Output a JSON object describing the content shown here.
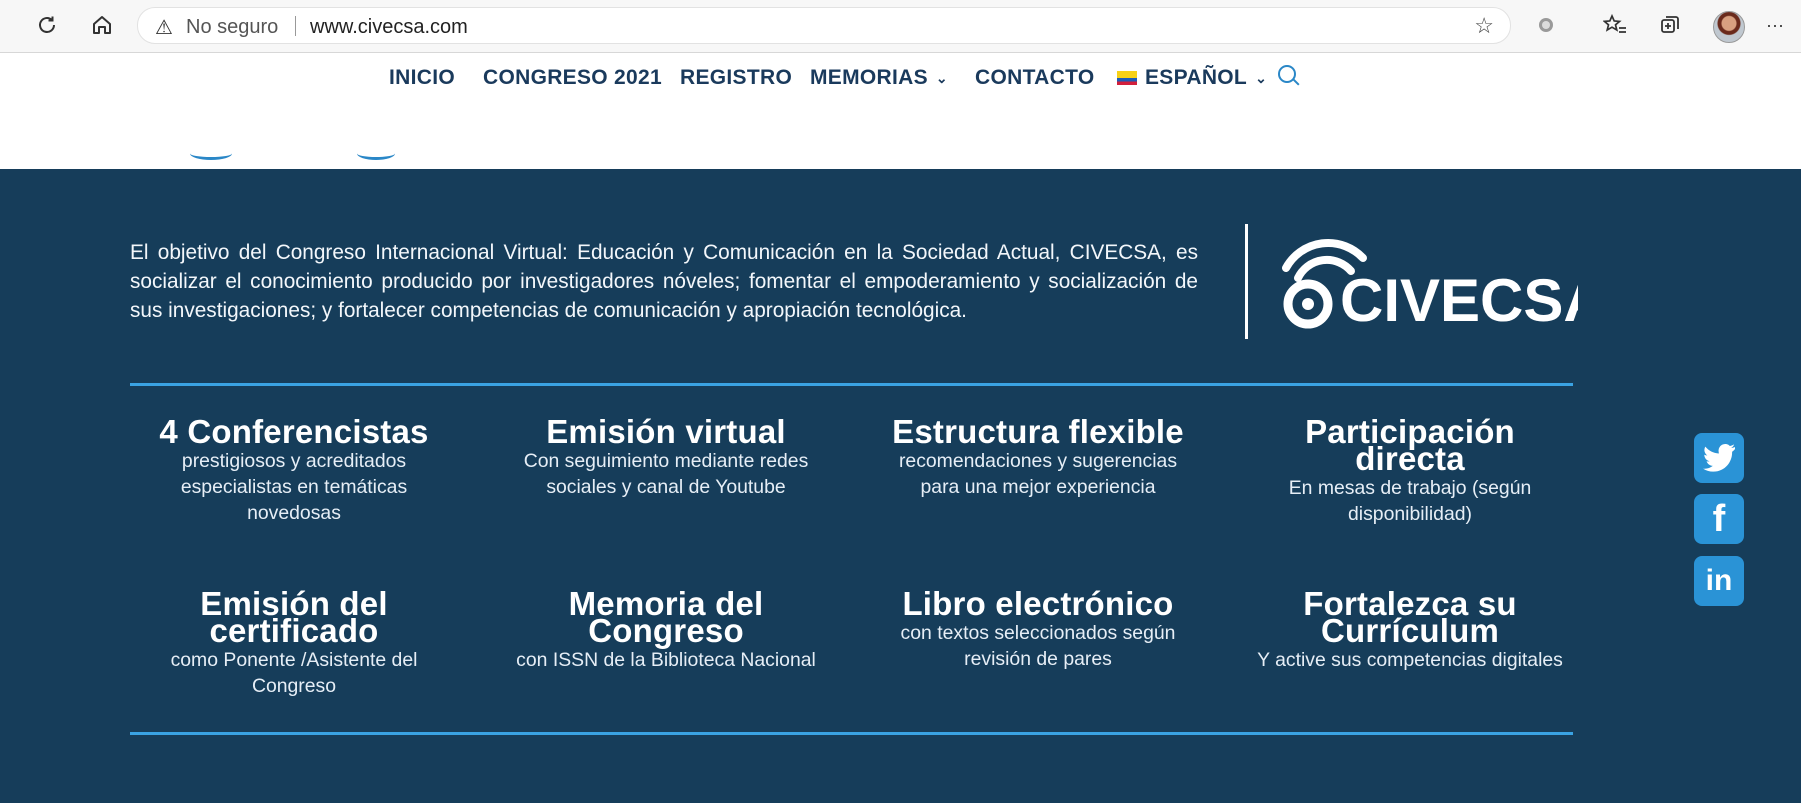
{
  "browser": {
    "security_label": "No seguro",
    "url": "www.civecsa.com",
    "icons": [
      "refresh-icon",
      "home-icon",
      "warning-icon",
      "add-favorite-icon",
      "extension-icon",
      "favorites-icon",
      "collections-icon",
      "profile-avatar",
      "more-icon"
    ]
  },
  "nav": {
    "items": [
      {
        "label": "INICIO"
      },
      {
        "label": "CONGRESO 2021"
      },
      {
        "label": "REGISTRO"
      },
      {
        "label": "MEMORIAS"
      },
      {
        "label": "CONTACTO"
      },
      {
        "label": "ESPAÑOL"
      }
    ]
  },
  "hero": {
    "intro": "El objetivo del Congreso Internacional Virtual: Educación y Comunicación en la Sociedad Actual, CIVECSA, es socializar el conocimiento producido por investigadores nóveles; fomentar el empoderamiento y socialización de sus investigaciones; y fortalecer competencias de comunicación y apropiación tecnológica.",
    "logo_text": "CIVECSA",
    "features": [
      {
        "title": "4 Conferencistas",
        "desc": "prestigiosos y acreditados especialistas en temáticas novedosas"
      },
      {
        "title": "Emisión virtual",
        "desc": "Con seguimiento mediante redes sociales y canal de Youtube"
      },
      {
        "title": "Estructura flexible",
        "desc": "recomendaciones y sugerencias para una mejor experiencia"
      },
      {
        "title": "Participación directa",
        "desc": "En mesas de trabajo (según disponibilidad)"
      },
      {
        "title": "Emisión del certificado",
        "desc": "como Ponente /Asistente del Congreso"
      },
      {
        "title": "Memoria del Congreso",
        "desc": "con ISSN de la Biblioteca Nacional"
      },
      {
        "title": "Libro electrónico",
        "desc": "con textos seleccionados según revisión de pares"
      },
      {
        "title": "Fortalezca su Currículum",
        "desc": "Y active sus competencias digitales"
      }
    ]
  },
  "social": {
    "items": [
      {
        "name": "twitter-icon",
        "color": "#2a93d6"
      },
      {
        "name": "facebook-icon",
        "color": "#2a93d6"
      },
      {
        "name": "linkedin-icon",
        "color": "#2a93d6"
      }
    ]
  },
  "colors": {
    "hero_bg": "#163d5a",
    "accent": "#3aa3e3",
    "nav_text": "#1a3a5c"
  }
}
